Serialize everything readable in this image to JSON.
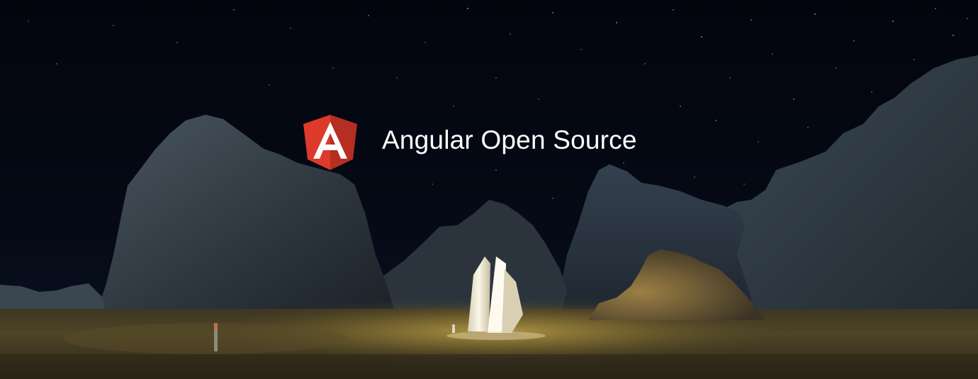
{
  "banner": {
    "title": "Angular Open Source",
    "logo_letter": "A",
    "logo_icon": "angular-shield-icon",
    "colors": {
      "logo_red": "#dd3a2c",
      "logo_dark_red": "#b52e22",
      "title_text": "#ffffff",
      "sky": "#03050c",
      "ground_glow": "#a8893c"
    }
  }
}
